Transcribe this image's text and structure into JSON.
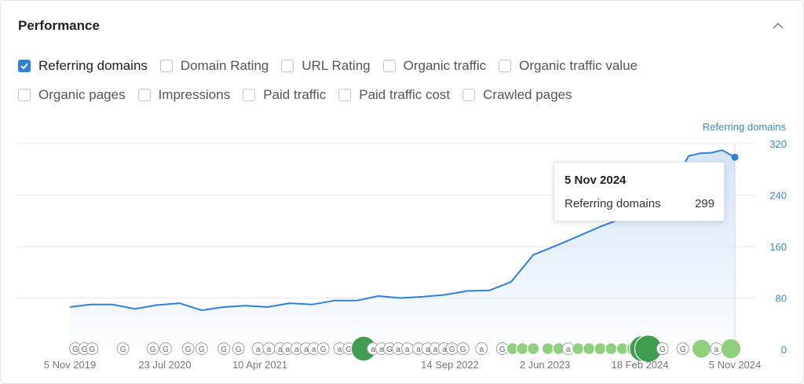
{
  "panel": {
    "title": "Performance",
    "collapse_icon": "chevron-up-icon"
  },
  "metrics_row1": [
    {
      "label": "Referring domains",
      "checked": true
    },
    {
      "label": "Domain Rating",
      "checked": false
    },
    {
      "label": "URL Rating",
      "checked": false
    },
    {
      "label": "Organic traffic",
      "checked": false
    },
    {
      "label": "Organic traffic value",
      "checked": false
    }
  ],
  "metrics_row2": [
    {
      "label": "Organic pages",
      "checked": false
    },
    {
      "label": "Impressions",
      "checked": false
    },
    {
      "label": "Paid traffic",
      "checked": false
    },
    {
      "label": "Paid traffic cost",
      "checked": false
    },
    {
      "label": "Crawled pages",
      "checked": false
    }
  ],
  "tooltip": {
    "date": "5 Nov 2024",
    "series": "Referring domains",
    "value": "299"
  },
  "colors": {
    "line": "#2f80d9",
    "area_top": "#d3e4f7",
    "grid": "#e6e8eb",
    "tick_right": "#3a8ad8",
    "tick_bottom": "#777777",
    "update_dot_light": "#8fcf7e",
    "update_dot_dark": "#3f9d4f",
    "update_marker_border": "#9aa0a6"
  },
  "chart_data": {
    "type": "area",
    "series_label": "Referring domains",
    "y_ticks": [
      0,
      80,
      160,
      240,
      320
    ],
    "ylim": [
      0,
      320
    ],
    "x_ticks": [
      "5 Nov 2019",
      "23 Jul 2020",
      "10 Apr 2021",
      "14 Sep 2022",
      "2 Jun 2023",
      "18 Feb 2024",
      "5 Nov 2024"
    ],
    "xlim": [
      "2019-11-05",
      "2024-11-05"
    ],
    "grid": true,
    "x": [
      "2019-11-05",
      "2020-01-01",
      "2020-03-01",
      "2020-05-01",
      "2020-07-01",
      "2020-09-01",
      "2020-11-01",
      "2021-01-01",
      "2021-03-01",
      "2021-05-01",
      "2021-07-01",
      "2021-09-01",
      "2021-11-01",
      "2022-01-01",
      "2022-03-01",
      "2022-05-01",
      "2022-07-01",
      "2022-09-01",
      "2022-11-01",
      "2023-01-01",
      "2023-03-01",
      "2023-05-01",
      "2023-07-01",
      "2023-09-01",
      "2023-11-01",
      "2024-01-01",
      "2024-03-01",
      "2024-05-01",
      "2024-07-01",
      "2024-08-01",
      "2024-09-01",
      "2024-10-01",
      "2024-11-05"
    ],
    "y": [
      66,
      70,
      70,
      63,
      69,
      72,
      61,
      66,
      68,
      66,
      72,
      70,
      76,
      76,
      83,
      80,
      82,
      85,
      91,
      92,
      105,
      147,
      161,
      176,
      191,
      204,
      219,
      240,
      301,
      305,
      306,
      310,
      299
    ],
    "update_markers": {
      "x": [
        "2019-11-20",
        "2019-12-15",
        "2020-01-05",
        "2020-03-30",
        "2020-06-20",
        "2020-07-25",
        "2020-09-25",
        "2020-11-01",
        "2021-01-01",
        "2021-02-10",
        "2021-04-05",
        "2021-05-05",
        "2021-06-05",
        "2021-06-25",
        "2021-07-20",
        "2021-08-15",
        "2021-09-05",
        "2021-10-01",
        "2021-11-15",
        "2021-12-10",
        "2022-01-20",
        "2022-02-15",
        "2022-03-10",
        "2022-04-01",
        "2022-04-25",
        "2022-05-20",
        "2022-06-20",
        "2022-07-15",
        "2022-08-05",
        "2022-08-30",
        "2022-09-20",
        "2022-10-20",
        "2022-12-10",
        "2023-02-05",
        "2023-03-05",
        "2023-04-01",
        "2023-05-01",
        "2023-06-10",
        "2023-07-10",
        "2023-08-05",
        "2023-09-01",
        "2023-10-01",
        "2023-11-01",
        "2023-12-01",
        "2024-01-01",
        "2024-02-01",
        "2024-02-25",
        "2024-03-12",
        "2024-04-20",
        "2024-06-15",
        "2024-08-05",
        "2024-09-15",
        "2024-10-25"
      ],
      "kind": [
        "g",
        "g",
        "g",
        "g",
        "g",
        "g",
        "g",
        "g",
        "g",
        "g",
        "a",
        "a",
        "a",
        "a",
        "a",
        "a",
        "a",
        "g",
        "a",
        "g",
        "dark",
        "a",
        "a",
        "g",
        "a",
        "a",
        "a",
        "a",
        "a",
        "a",
        "g",
        "g",
        "a",
        "g",
        "light",
        "light",
        "light",
        "light",
        "light",
        "a",
        "light",
        "light",
        "light",
        "light",
        "light",
        "light",
        "dark",
        "dark",
        "g",
        "g",
        "light",
        "a",
        "light"
      ],
      "size": [
        1,
        1,
        1,
        1,
        1,
        1,
        1,
        1,
        1,
        1,
        1,
        1,
        1,
        1,
        1,
        1,
        1,
        1,
        1,
        1,
        2.1,
        1,
        1,
        1,
        1,
        1,
        1,
        1,
        1,
        1,
        1,
        1,
        1,
        1,
        1,
        1,
        1,
        1,
        1,
        1,
        1,
        1,
        1,
        1,
        1,
        1.2,
        2.2,
        2.3,
        1,
        1,
        1.6,
        1,
        1.7
      ]
    }
  }
}
